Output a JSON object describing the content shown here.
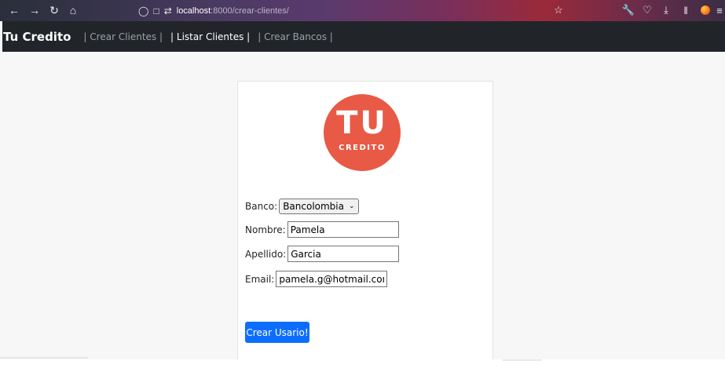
{
  "browser": {
    "url_host": "localhost",
    "url_path": ":8000/crear-clientes/",
    "icons": [
      "back-icon",
      "forward-icon",
      "reload-icon",
      "home-icon",
      "shield-icon",
      "page-icon",
      "permissions-icon",
      "bookmark-star-icon",
      "wrench-icon",
      "pocket-icon",
      "download-icon",
      "library-icon",
      "firefox-account-icon",
      "menu-icon"
    ]
  },
  "navbar": {
    "brand": "Tu Credito",
    "links": [
      {
        "label": "| Crear Clientes |",
        "active": false
      },
      {
        "label": "| Listar Clientes |",
        "active": true
      },
      {
        "label": "| Crear Bancos |",
        "active": false
      }
    ]
  },
  "logo": {
    "big": "TU",
    "small": "CREDITO",
    "color": "#e85a45"
  },
  "form": {
    "banco_label": "Banco:",
    "banco_value": "Bancolombia",
    "nombre_label": "Nombre:",
    "nombre_value": "Pamela",
    "apellido_label": "Apellido:",
    "apellido_value": "Garcia",
    "email_label": "Email:",
    "email_value": "pamela.g@hotmail.com",
    "submit_label": "Crear Usario!"
  },
  "colors": {
    "navbar_bg": "#212529",
    "button_bg": "#0d6efd",
    "page_bg": "#f7f7f7"
  }
}
